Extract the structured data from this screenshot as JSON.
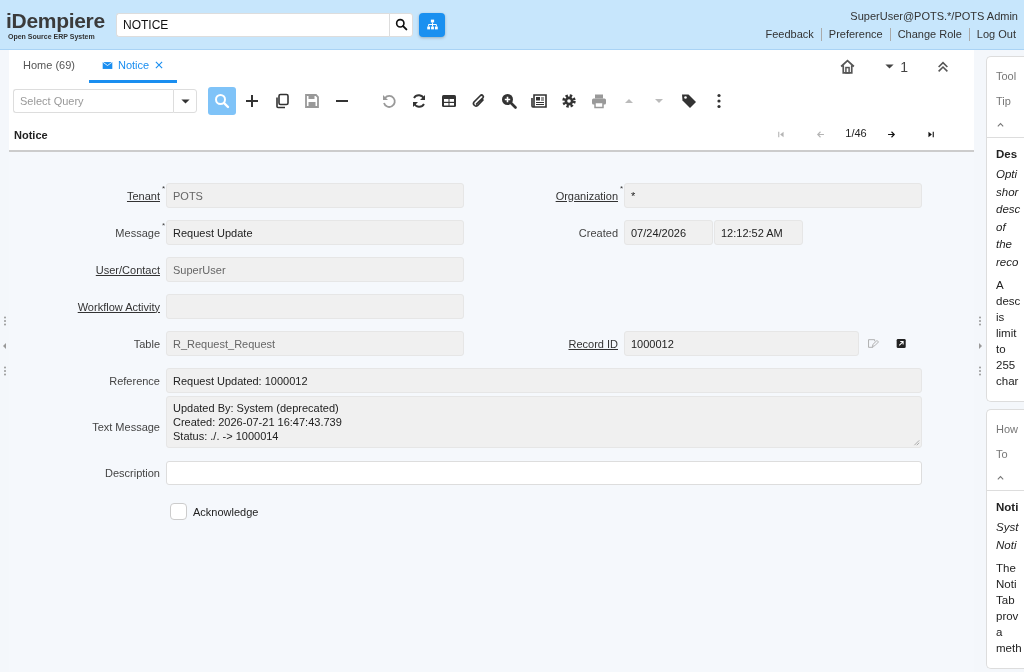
{
  "header": {
    "logo": "iDempiere",
    "logo_tagline": "Open Source ERP System",
    "search_value": "NOTICE",
    "user": "SuperUser@POTS.*/POTS Admin",
    "links": [
      "Feedback",
      "Preference",
      "Change Role",
      "Log Out"
    ]
  },
  "tabs": [
    {
      "label": "Home (69)",
      "selected": false,
      "closable": false
    },
    {
      "label": "Notice",
      "selected": true,
      "closable": true
    }
  ],
  "tab_bar": {
    "count": "1"
  },
  "toolbar": {
    "query_placeholder": "Select Query",
    "buttons": [
      {
        "kind": "find",
        "active": true,
        "disabled": false
      },
      {
        "kind": "new",
        "active": false,
        "disabled": false
      },
      {
        "kind": "copy",
        "active": false,
        "disabled": false
      },
      {
        "kind": "save",
        "active": false,
        "disabled": true
      },
      {
        "kind": "delete",
        "active": false,
        "disabled": false
      },
      {
        "kind": "undo",
        "active": false,
        "disabled": true
      },
      {
        "kind": "refresh",
        "active": false,
        "disabled": false
      },
      {
        "kind": "grid",
        "active": false,
        "disabled": false
      },
      {
        "kind": "attach",
        "active": false,
        "disabled": false
      },
      {
        "kind": "zoom",
        "active": false,
        "disabled": false
      },
      {
        "kind": "report",
        "active": false,
        "disabled": false
      },
      {
        "kind": "process",
        "active": false,
        "disabled": false
      },
      {
        "kind": "print",
        "active": false,
        "disabled": true
      },
      {
        "kind": "up",
        "active": false,
        "disabled": true
      },
      {
        "kind": "down",
        "active": false,
        "disabled": true
      },
      {
        "kind": "tag",
        "active": false,
        "disabled": false
      },
      {
        "kind": "more",
        "active": false,
        "disabled": false
      }
    ]
  },
  "record": {
    "title": "Notice",
    "position": "1/46",
    "nav": [
      {
        "kind": "first",
        "disabled": true
      },
      {
        "kind": "previous",
        "disabled": true
      },
      {
        "kind": "next",
        "disabled": false
      },
      {
        "kind": "last",
        "disabled": false
      }
    ]
  },
  "form": {
    "rows": [
      {
        "fields": [
          {
            "kind": "lookup",
            "label": "Tenant",
            "link": true,
            "mark": "*",
            "value": "POTS"
          },
          {
            "kind": "text",
            "label": "Organization",
            "link": true,
            "mark": "*",
            "value": "*"
          }
        ]
      },
      {
        "fields": [
          {
            "kind": "text",
            "label": "Message",
            "link": false,
            "mark": "*",
            "value": "Request Update"
          },
          {
            "kind": "datetime",
            "label": "Created",
            "link": false,
            "value": "07/24/2026",
            "time": "12:12:52 AM"
          }
        ]
      },
      {
        "fields": [
          {
            "kind": "lookup",
            "label": "User/Contact",
            "link": true,
            "value": "SuperUser"
          }
        ]
      },
      {
        "fields": [
          {
            "kind": "lookup",
            "label": "Workflow Activity",
            "link": true
          }
        ]
      },
      {
        "fields": [
          {
            "kind": "lookup",
            "label": "Table",
            "link": false,
            "value": "R_Request_Request"
          },
          {
            "kind": "record-id",
            "label": "Record ID",
            "link": true,
            "value": "1000012"
          }
        ]
      },
      {
        "fields": [
          {
            "kind": "wide",
            "label": "Reference",
            "link": false,
            "value": "Request Updated: 1000012"
          }
        ]
      },
      {
        "fields": [
          {
            "kind": "textarea",
            "label": "Text Message",
            "link": false,
            "lines": [
              "Updated By: System (deprecated)",
              "Created: 2026-07-21 16:47:43.739",
              "Status: ./. -> 1000014"
            ]
          }
        ]
      },
      {
        "fields": [
          {
            "kind": "input",
            "label": "Description",
            "link": false
          }
        ]
      },
      {
        "fields": [
          {
            "kind": "checkbox",
            "label": "Acknowledge",
            "checked": false
          }
        ]
      }
    ]
  },
  "help": [
    {
      "title": "Tool Tip",
      "heading": "Des",
      "summary": "Opti shor desc of the reco",
      "body": "A desc is limit to 255 char"
    },
    {
      "title": "How To",
      "heading": "Noti",
      "summary": "Syst Noti",
      "body": "The Noti Tab prov a meth"
    }
  ]
}
